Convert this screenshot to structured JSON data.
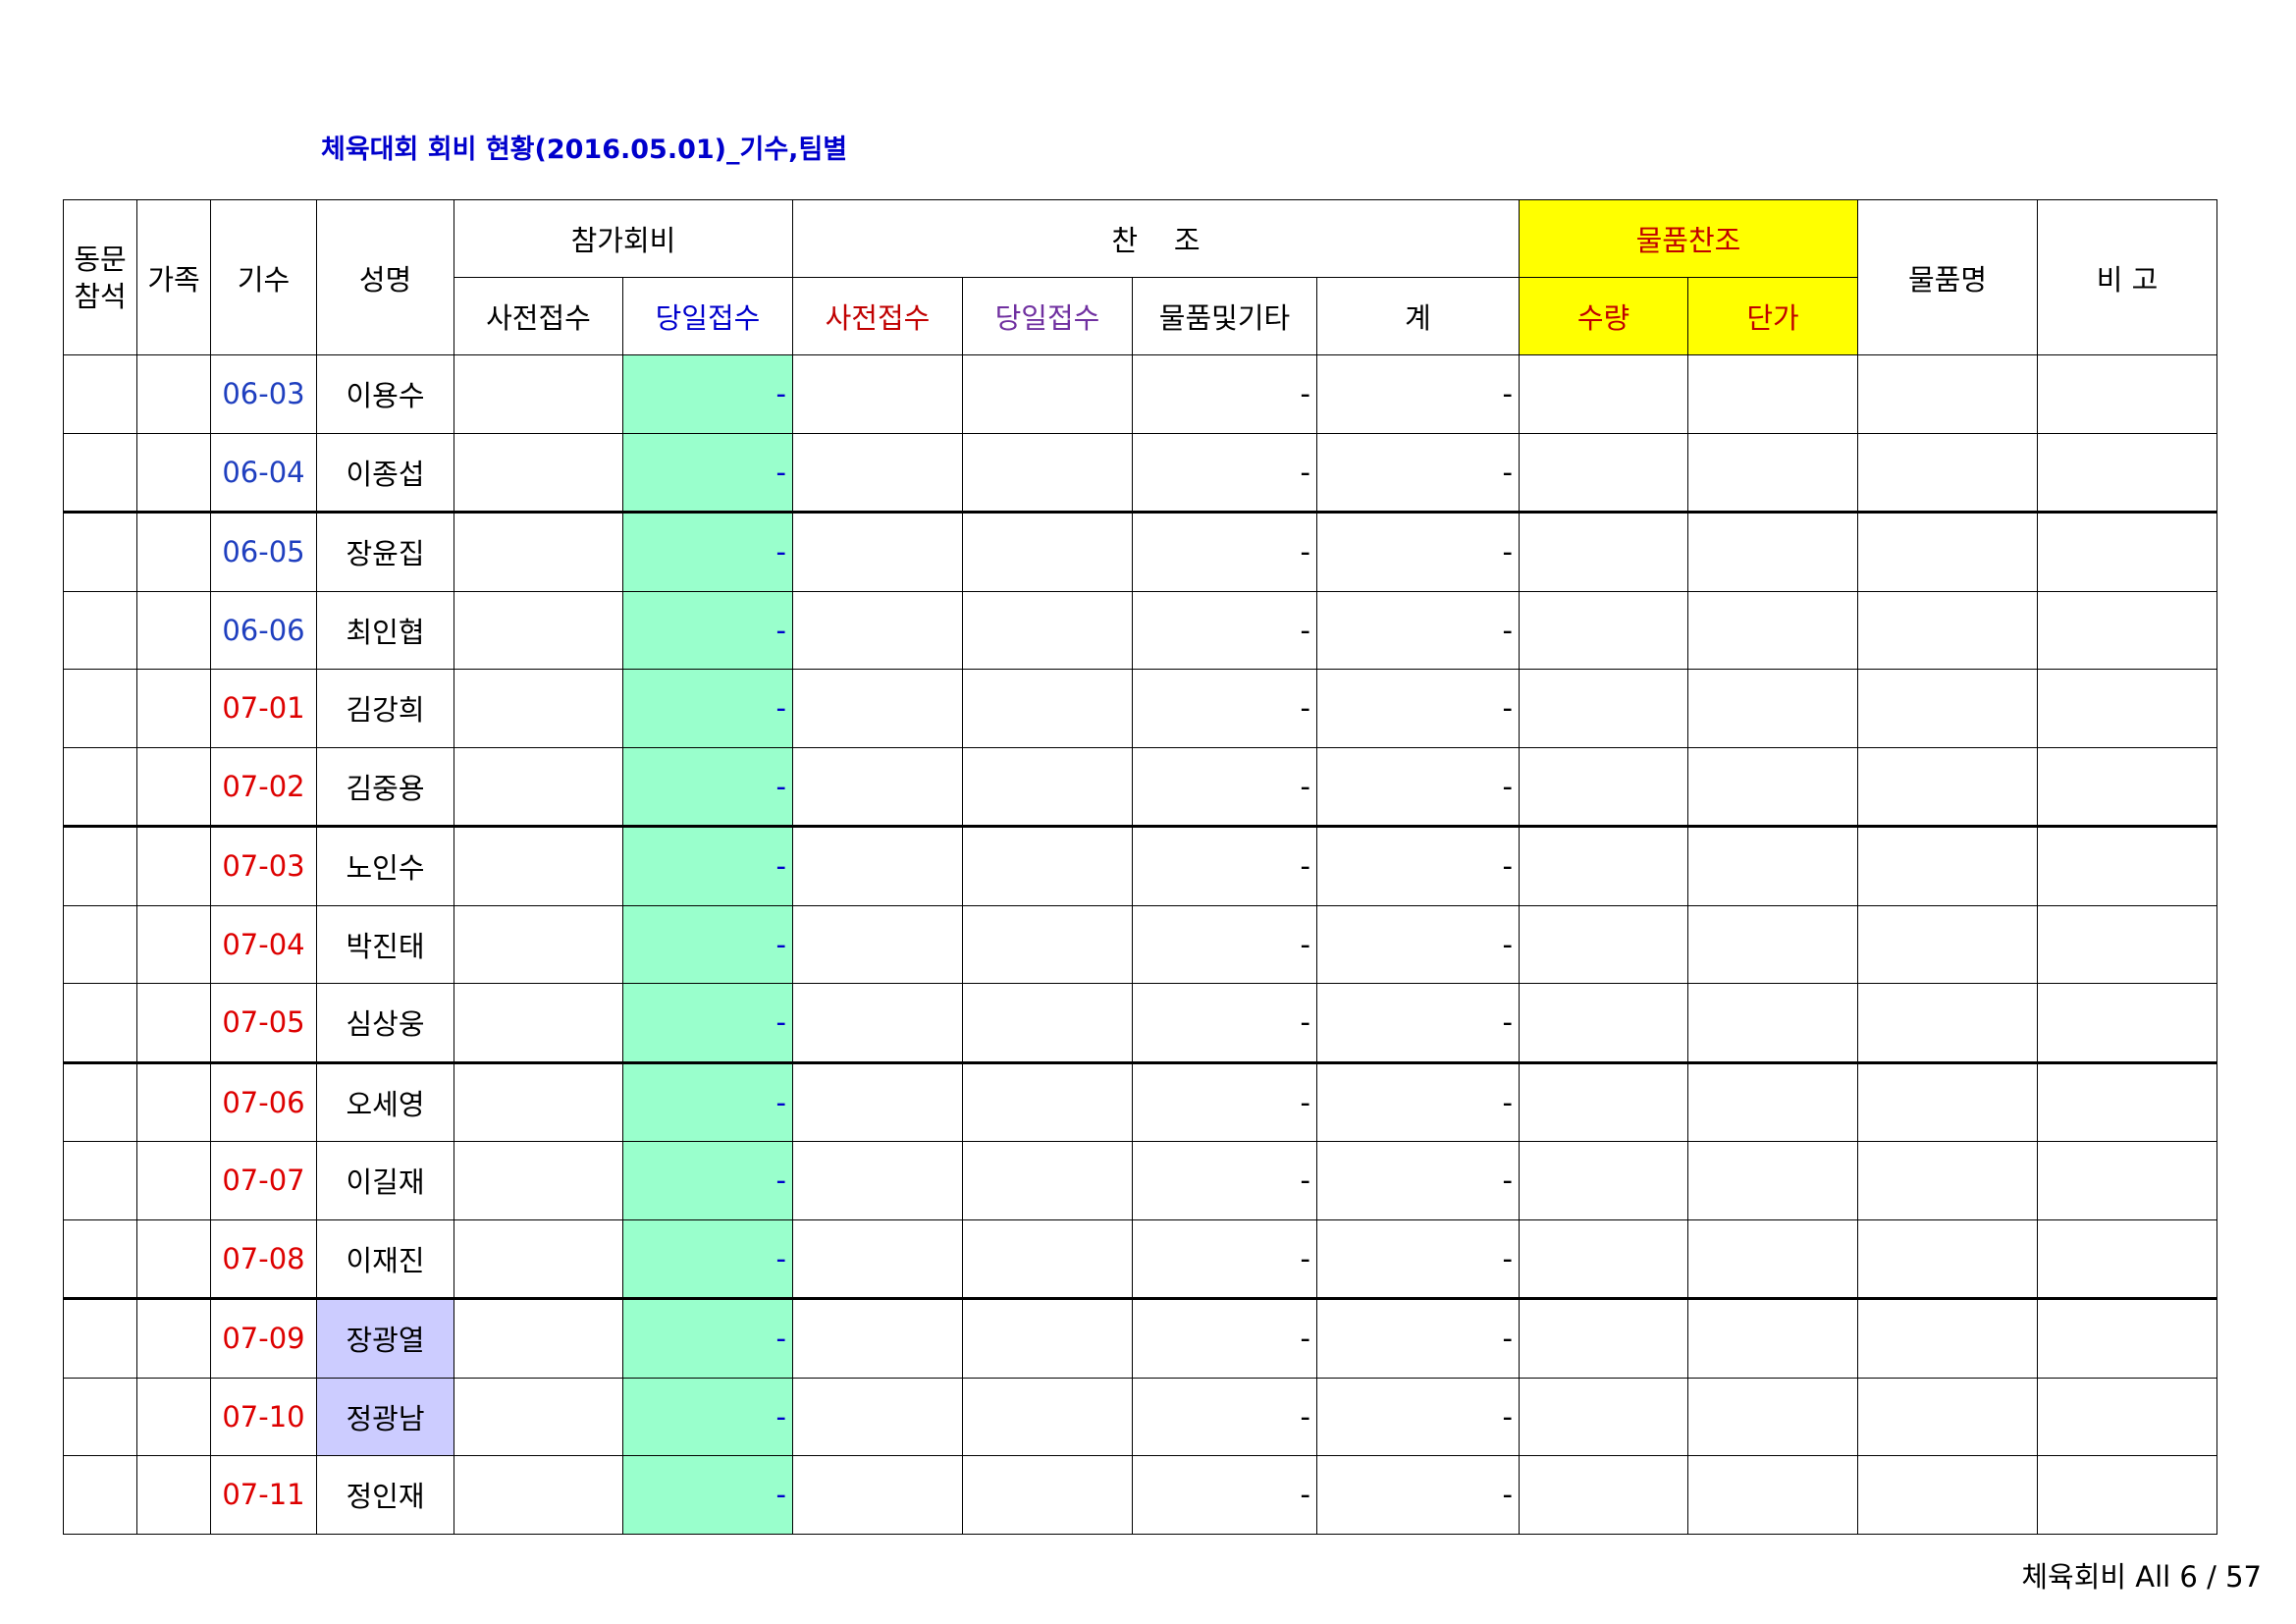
{
  "title": "체육대회 회비 현황(2016.05.01)_기수,팀별",
  "header": {
    "dongmun": "동문\n참석",
    "family": "가족",
    "gisu": "기수",
    "name": "성명",
    "fee_group": "참가회비",
    "fee_pre": "사전접수",
    "fee_day": "당일접수",
    "sponsor_group": "찬    조",
    "sp_pre": "사전접수",
    "sp_day": "당일접수",
    "sp_goods": "물품및기타",
    "sp_total": "계",
    "goods_group": "물품찬조",
    "goods_qty": "수량",
    "goods_price": "단가",
    "goods_name": "물품명",
    "remark": "비 고"
  },
  "rows": [
    {
      "gisu": "06-03",
      "name": "이용수",
      "fee_day": "-",
      "sp_goods": "-",
      "sp_total": "-"
    },
    {
      "gisu": "06-04",
      "name": "이종섭",
      "fee_day": "-",
      "sp_goods": "-",
      "sp_total": "-"
    },
    {
      "gisu": "06-05",
      "name": "장윤집",
      "fee_day": "-",
      "sp_goods": "-",
      "sp_total": "-"
    },
    {
      "gisu": "06-06",
      "name": "최인협",
      "fee_day": "-",
      "sp_goods": "-",
      "sp_total": "-"
    },
    {
      "gisu": "07-01",
      "name": "김강희",
      "fee_day": "-",
      "sp_goods": "-",
      "sp_total": "-"
    },
    {
      "gisu": "07-02",
      "name": "김중용",
      "fee_day": "-",
      "sp_goods": "-",
      "sp_total": "-"
    },
    {
      "gisu": "07-03",
      "name": "노인수",
      "fee_day": "-",
      "sp_goods": "-",
      "sp_total": "-"
    },
    {
      "gisu": "07-04",
      "name": "박진태",
      "fee_day": "-",
      "sp_goods": "-",
      "sp_total": "-"
    },
    {
      "gisu": "07-05",
      "name": "심상웅",
      "fee_day": "-",
      "sp_goods": "-",
      "sp_total": "-"
    },
    {
      "gisu": "07-06",
      "name": "오세영",
      "fee_day": "-",
      "sp_goods": "-",
      "sp_total": "-"
    },
    {
      "gisu": "07-07",
      "name": "이길재",
      "fee_day": "-",
      "sp_goods": "-",
      "sp_total": "-"
    },
    {
      "gisu": "07-08",
      "name": "이재진",
      "fee_day": "-",
      "sp_goods": "-",
      "sp_total": "-"
    },
    {
      "gisu": "07-09",
      "name": "장광열",
      "fee_day": "-",
      "sp_goods": "-",
      "sp_total": "-"
    },
    {
      "gisu": "07-10",
      "name": "정광남",
      "fee_day": "-",
      "sp_goods": "-",
      "sp_total": "-"
    },
    {
      "gisu": "07-11",
      "name": "정인재",
      "fee_day": "-",
      "sp_goods": "-",
      "sp_total": "-"
    }
  ],
  "footer": "체육회비 All 6 / 57",
  "colors": {
    "title": "#0000cc",
    "yellow_header": "#ffff00",
    "fee_day_fill": "#99ffcc",
    "name_highlight": "#ccccff",
    "gisu_06": "#1f3fbf",
    "gisu_07": "#dd0000"
  }
}
